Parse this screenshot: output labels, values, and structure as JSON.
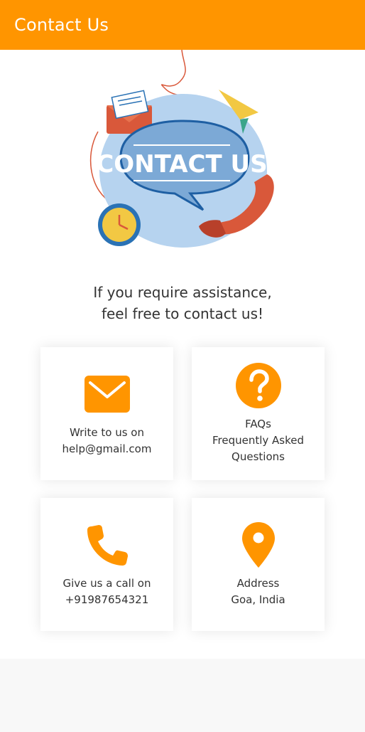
{
  "header": {
    "title": "Contact Us"
  },
  "illustration": {
    "banner_text": "CONTACT US",
    "icon": "contact-us-illustration"
  },
  "tagline": {
    "line1": "If you require assistance,",
    "line2": "feel free to contact us!"
  },
  "cards": {
    "email": {
      "icon": "envelope-icon",
      "line1": "Write to us on",
      "line2": "help@gmail.com"
    },
    "faq": {
      "icon": "question-icon",
      "line1": "FAQs",
      "line2": "Frequently Asked",
      "line3": "Questions"
    },
    "phone": {
      "icon": "phone-icon",
      "line1": "Give us a call on",
      "line2": "+91987654321"
    },
    "address": {
      "icon": "location-pin-icon",
      "line1": "Address",
      "line2": "Goa, India"
    }
  },
  "colors": {
    "accent": "#ff9500",
    "header_text": "#ffffff",
    "body_text": "#333333"
  }
}
